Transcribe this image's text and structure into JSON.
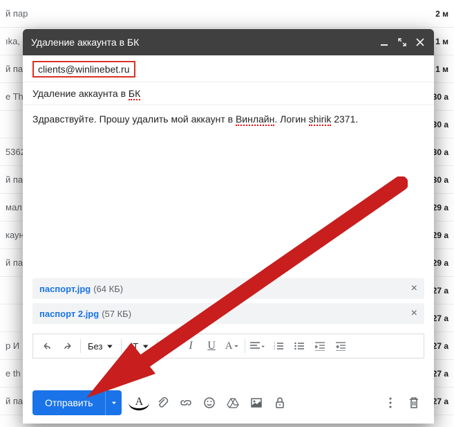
{
  "inbox": {
    "rows": [
      {
        "snippet": "й пар",
        "date": "2 м"
      },
      {
        "snippet": "ıka,",
        "date": "1 м"
      },
      {
        "snippet": "й пар",
        "date": "1 м"
      },
      {
        "snippet": "e The",
        "date": "30 а"
      },
      {
        "snippet": "",
        "date": "30 а"
      },
      {
        "snippet": "5362",
        "date": "30 а"
      },
      {
        "snippet": "й пар",
        "date": "30 а"
      },
      {
        "snippet": "мал",
        "date": "29 а"
      },
      {
        "snippet": "каун",
        "date": "29 а"
      },
      {
        "snippet": "й пар",
        "date": "29 а"
      },
      {
        "snippet": "",
        "date": "27 а"
      },
      {
        "snippet": "",
        "date": "27 а"
      },
      {
        "snippet": "р И",
        "date": "27 а"
      },
      {
        "snippet": "e th",
        "date": "27 а"
      },
      {
        "snippet": "й пар",
        "date": "27 а"
      }
    ]
  },
  "compose": {
    "title": "Удаление аккаунта в БК",
    "to": "clients@winlinebet.ru",
    "subject_parts": {
      "p1": "Удаление аккаунта в ",
      "p2": "БК"
    },
    "body_parts": {
      "p1": "Здравствуйте. Прошу удалить мой аккаунт в ",
      "p2": "Винлайн",
      "p3": ". Логин ",
      "p4": "shirik",
      "p5": " 2371."
    },
    "attachments": [
      {
        "name": "паспорт.jpg",
        "size": "(64 КБ)"
      },
      {
        "name": "паспорт 2.jpg",
        "size": "(57 КБ)"
      }
    ],
    "font_label": "Без",
    "size_label": "тТ",
    "send_label": "Отправить"
  }
}
